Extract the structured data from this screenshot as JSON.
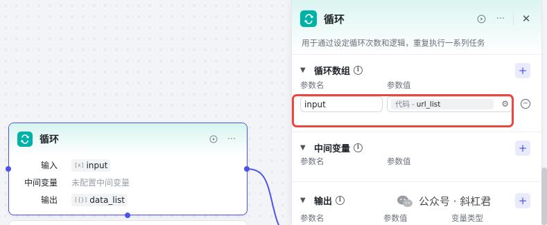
{
  "node": {
    "title": "循环",
    "rows": [
      {
        "key": "输入",
        "tag_icon": "[x]",
        "value": "input"
      },
      {
        "key": "中间变量",
        "value": "未配置中间变量"
      },
      {
        "key": "输出",
        "tag_icon": "[{}]",
        "value": "data_list"
      }
    ]
  },
  "panel": {
    "title": "循环",
    "description": "用于通过设定循环次数和逻辑，重复执行一系列任务",
    "sections": {
      "loop_array": {
        "title": "循环数组",
        "col_name": "参数名",
        "col_value": "参数值",
        "param_name": "input",
        "ref_source": "代码",
        "ref_separator": "-",
        "ref_variable": "url_list"
      },
      "intermediate": {
        "title": "中间变量",
        "col_name": "参数名",
        "col_value": "参数值"
      },
      "output": {
        "title": "输出",
        "col_name": "参数名",
        "col_value": "参数值",
        "col_type": "变量类型"
      }
    }
  },
  "watermark": {
    "text": "公众号 · 斜杠君"
  },
  "colors": {
    "accent": "#4d53e8",
    "teal": "#00b2a6",
    "highlight": "#e8483f"
  }
}
